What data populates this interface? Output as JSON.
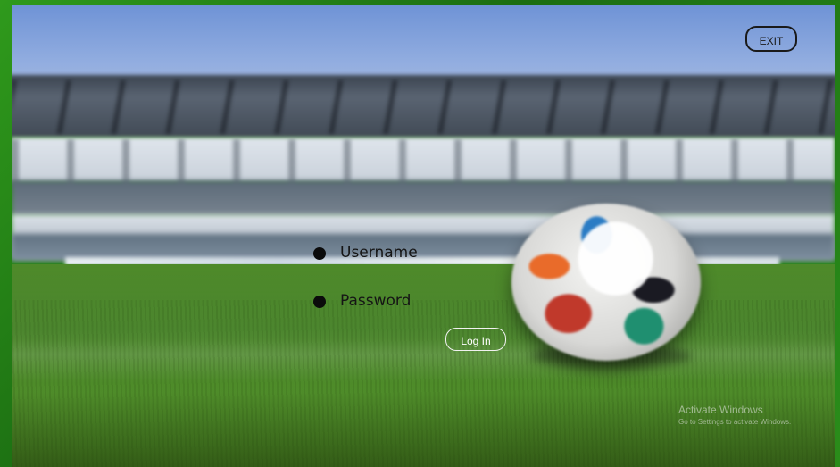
{
  "window": {
    "frame_color": "#2a8d1a"
  },
  "header": {
    "exit_label": "EXIT"
  },
  "login": {
    "username_placeholder": "Username",
    "password_placeholder": "Password",
    "login_label": "Log In"
  },
  "watermark": {
    "title": "Activate Windows",
    "subtitle": "Go to Settings to activate Windows."
  },
  "icons": {
    "username_bullet": "bullet-icon",
    "password_bullet": "bullet-icon"
  },
  "colors": {
    "bullet": "#0b0b0b",
    "exit_border": "#1a1a1a",
    "login_border": "#f1f1f1"
  }
}
